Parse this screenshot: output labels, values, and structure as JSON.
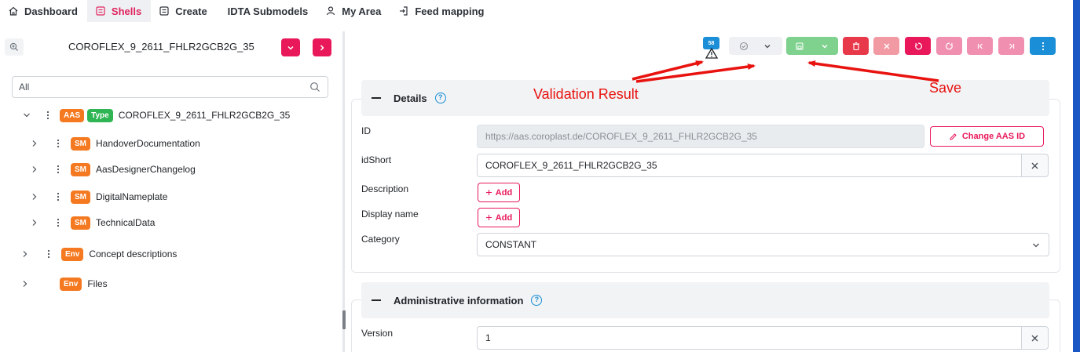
{
  "nav": {
    "items": [
      {
        "label": "Dashboard",
        "icon": "home-icon",
        "active": false
      },
      {
        "label": "Shells",
        "icon": "list-icon",
        "active": true
      },
      {
        "label": "Create",
        "icon": "list-icon",
        "active": false
      },
      {
        "label": "IDTA Submodels",
        "icon": "",
        "active": false
      },
      {
        "label": "My Area",
        "icon": "user-icon",
        "active": false
      },
      {
        "label": "Feed mapping",
        "icon": "login-icon",
        "active": false
      }
    ]
  },
  "left": {
    "shell_title": "COROFLEX_9_2611_FHLR2GCB2G_35",
    "filter_value": "All",
    "tree": {
      "root": {
        "badges": [
          "AAS",
          "Type"
        ],
        "label": "COROFLEX_9_2611_FHLR2GCB2G_35"
      },
      "submodels": [
        {
          "badge": "SM",
          "label": "HandoverDocumentation"
        },
        {
          "badge": "SM",
          "label": "AasDesignerChangelog"
        },
        {
          "badge": "SM",
          "label": "DigitalNameplate"
        },
        {
          "badge": "SM",
          "label": "TechnicalData"
        }
      ],
      "env_items": [
        {
          "badge": "Env",
          "label": "Concept descriptions"
        },
        {
          "badge": "Env",
          "label": "Files"
        }
      ]
    }
  },
  "toolbar": {
    "validation_count": "58"
  },
  "details": {
    "title": "Details",
    "help": "?",
    "id_label": "ID",
    "id_value": "https://aas.coroplast.de/COROFLEX_9_2611_FHLR2GCB2G_35",
    "change_id_label": "Change AAS ID",
    "idshort_label": "idShort",
    "idshort_value": "COROFLEX_9_2611_FHLR2GCB2G_35",
    "description_label": "Description",
    "display_name_label": "Display name",
    "add_label": "Add",
    "category_label": "Category",
    "category_value": "CONSTANT"
  },
  "admin": {
    "title": "Administrative information",
    "help": "?",
    "version_label": "Version",
    "version_value": "1"
  },
  "annotations": {
    "validation": "Validation Result",
    "save": "Save"
  },
  "colors": {
    "accent": "#e8185a",
    "orange_badge": "#f47920",
    "green_badge": "#2fb553",
    "save_green": "#7fd18e",
    "delete_red": "#e8394b",
    "info_blue": "#1a8ed6",
    "annotation_red": "#e8130f"
  }
}
